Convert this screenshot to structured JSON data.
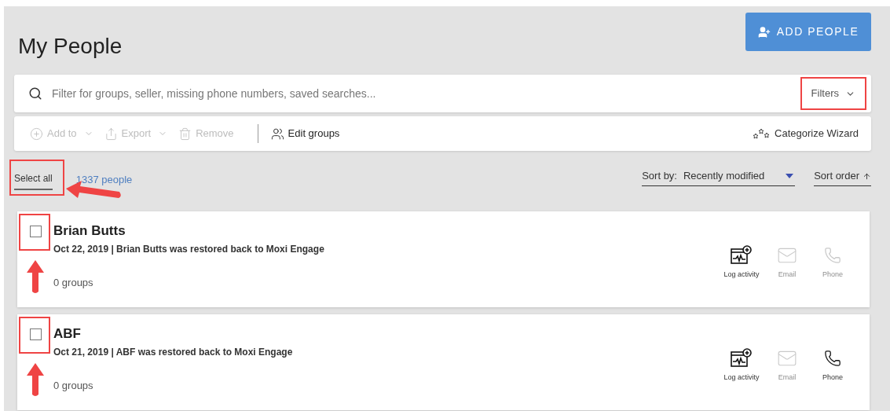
{
  "title": "My People",
  "add_button": {
    "label": "ADD PEOPLE"
  },
  "search": {
    "placeholder": "Filter for groups, seller, missing phone numbers, saved searches...",
    "filters_label": "Filters"
  },
  "toolbar": [
    {
      "label": "Add to",
      "kind": "add",
      "disabled": true,
      "dropdown": true
    },
    {
      "label": "Export",
      "kind": "export",
      "disabled": true,
      "dropdown": true
    },
    {
      "label": "Remove",
      "kind": "remove",
      "disabled": true,
      "dropdown": false
    },
    {
      "label": "Edit groups",
      "kind": "groups",
      "disabled": false,
      "dropdown": false
    }
  ],
  "categorize": {
    "label": "Categorize Wizard"
  },
  "select_all": {
    "label": "Select all"
  },
  "count": "1337 people",
  "sort": {
    "label": "Sort by:",
    "value": "Recently modified",
    "order_label": "Sort order"
  },
  "people": [
    {
      "name": "Brian Butts",
      "checked": false,
      "activity": "Oct 22, 2019 | Brian Butts was restored back to Moxi Engage",
      "groups": "0 groups",
      "actions": [
        {
          "kind": "log",
          "label": "Log activity",
          "disabled": false
        },
        {
          "kind": "email",
          "label": "Email",
          "disabled": true
        },
        {
          "kind": "phone",
          "label": "Phone",
          "disabled": true
        }
      ]
    },
    {
      "name": "ABF",
      "checked": false,
      "activity": "Oct 21, 2019 | ABF was restored back to Moxi Engage",
      "groups": "0 groups",
      "actions": [
        {
          "kind": "log",
          "label": "Log activity",
          "disabled": false
        },
        {
          "kind": "email",
          "label": "Email",
          "disabled": true
        },
        {
          "kind": "phone",
          "label": "Phone",
          "disabled": false
        }
      ]
    }
  ]
}
